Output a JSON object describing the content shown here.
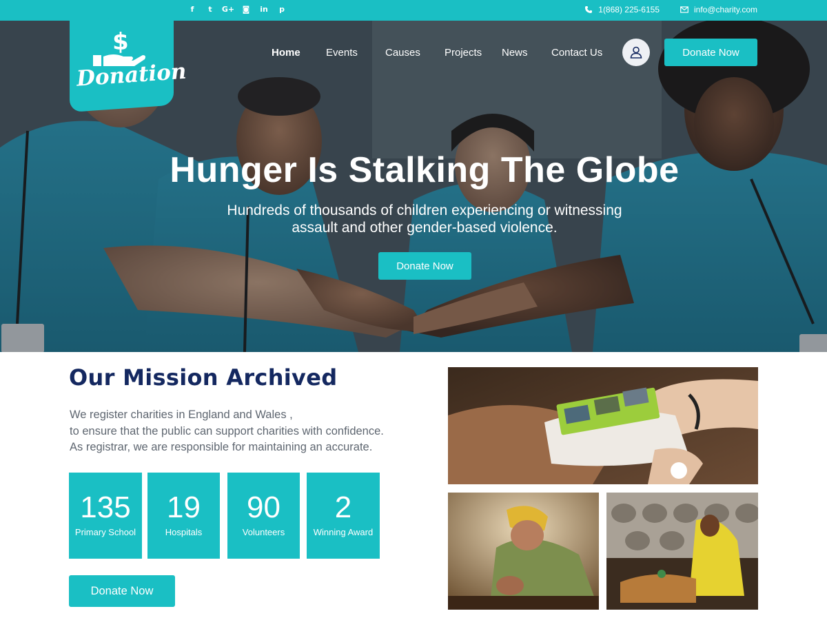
{
  "topbar": {
    "social": [
      {
        "icon": "facebook-icon",
        "glyph": "f"
      },
      {
        "icon": "twitter-icon",
        "glyph": "t"
      },
      {
        "icon": "google-plus-icon",
        "glyph": "G+"
      },
      {
        "icon": "instagram-icon",
        "glyph": "◙"
      },
      {
        "icon": "linkedin-icon",
        "glyph": "in"
      },
      {
        "icon": "pinterest-icon",
        "glyph": "p"
      }
    ],
    "phone": "1(868) 225-6155",
    "email": "info@charity.com"
  },
  "logo": {
    "text": "Donation",
    "symbol": "$"
  },
  "nav": {
    "items": [
      "Home",
      "Events",
      "Causes",
      "Projects",
      "News",
      "Contact Us"
    ],
    "active": "Home",
    "donate_label": "Donate Now"
  },
  "hero": {
    "title": "Hunger Is Stalking The Globe",
    "subtitle": "Hundreds of thousands of children experiencing or witnessing\nassault  and other gender-based violence.",
    "donate_label": "Donate Now"
  },
  "mission": {
    "title": "Our Mission Archived",
    "lines": [
      "We register charities in England and Wales ,",
      "to ensure that the public can support charities with confidence.",
      "As registrar, we are responsible for maintaining an accurate."
    ],
    "stats": [
      {
        "value": "135",
        "label": "Primary School"
      },
      {
        "value": "19",
        "label": "Hospitals"
      },
      {
        "value": "90",
        "label": "Volunteers"
      },
      {
        "value": "2",
        "label": "Winning Award"
      }
    ],
    "donate_label": "Donate Now"
  },
  "colors": {
    "accent": "#1abfc4",
    "heading": "#142860",
    "body_text": "#5e6670"
  }
}
